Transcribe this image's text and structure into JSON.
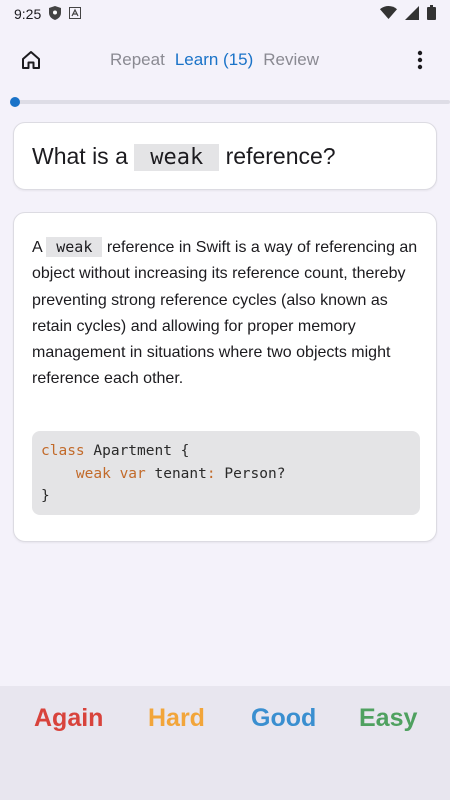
{
  "status_bar": {
    "time": "9:25"
  },
  "tabs": [
    {
      "label": "Repeat",
      "active": false
    },
    {
      "label": "Learn (15)",
      "active": true
    },
    {
      "label": "Review",
      "active": false
    }
  ],
  "progress": {
    "fraction": 0.0
  },
  "question": {
    "prefix": "What is a",
    "code": "weak",
    "suffix": "reference?"
  },
  "answer": {
    "prefix": "A",
    "code": "weak",
    "text": "reference in Swift is a way of referencing an object without increasing its reference count, thereby preventing strong reference cycles (also known as retain cycles) and allowing for proper memory management in situations where two objects might reference each other."
  },
  "code_block": {
    "line1_kw": "class",
    "line1_rest": " Apartment {",
    "line2_indent": "    ",
    "line2_kw": "weak var",
    "line2_name": " tenant",
    "line2_colon": ":",
    "line2_type": " Person?",
    "line3": "}"
  },
  "ratings": {
    "again": "Again",
    "hard": "Hard",
    "good": "Good",
    "easy": "Easy"
  },
  "colors": {
    "accent": "#1a73c8",
    "again": "#d8433c",
    "hard": "#f2a53a",
    "good": "#3a8fd0",
    "easy": "#4fa160",
    "keyword": "#c26a2a"
  },
  "icons": {
    "home": "home-icon",
    "menu": "more-vert-icon",
    "shield": "shield-icon",
    "notification": "a-notification-icon",
    "wifi": "wifi-icon",
    "signal": "signal-icon",
    "battery": "battery-icon"
  }
}
